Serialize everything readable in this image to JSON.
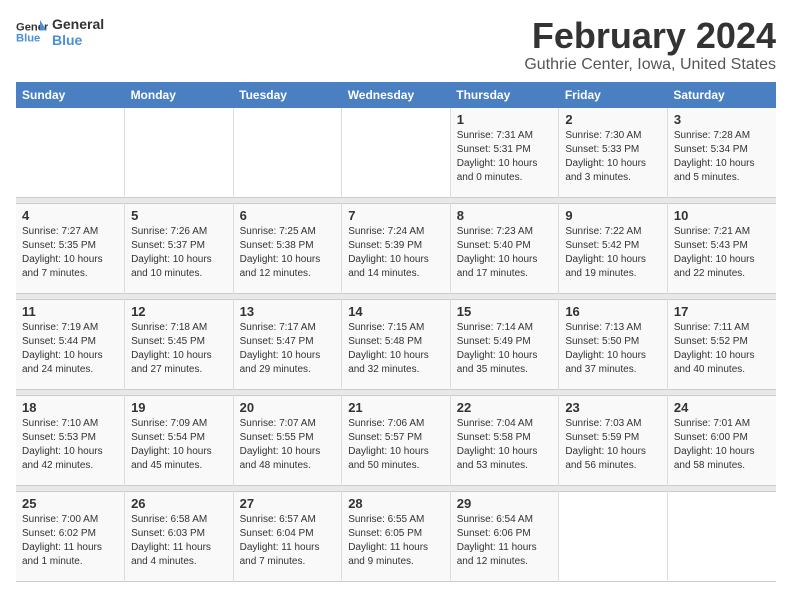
{
  "logo": {
    "line1": "General",
    "line2": "Blue"
  },
  "title": "February 2024",
  "location": "Guthrie Center, Iowa, United States",
  "weekdays": [
    "Sunday",
    "Monday",
    "Tuesday",
    "Wednesday",
    "Thursday",
    "Friday",
    "Saturday"
  ],
  "weeks": [
    [
      {
        "day": "",
        "info": ""
      },
      {
        "day": "",
        "info": ""
      },
      {
        "day": "",
        "info": ""
      },
      {
        "day": "",
        "info": ""
      },
      {
        "day": "1",
        "info": "Sunrise: 7:31 AM\nSunset: 5:31 PM\nDaylight: 10 hours\nand 0 minutes."
      },
      {
        "day": "2",
        "info": "Sunrise: 7:30 AM\nSunset: 5:33 PM\nDaylight: 10 hours\nand 3 minutes."
      },
      {
        "day": "3",
        "info": "Sunrise: 7:28 AM\nSunset: 5:34 PM\nDaylight: 10 hours\nand 5 minutes."
      }
    ],
    [
      {
        "day": "4",
        "info": "Sunrise: 7:27 AM\nSunset: 5:35 PM\nDaylight: 10 hours\nand 7 minutes."
      },
      {
        "day": "5",
        "info": "Sunrise: 7:26 AM\nSunset: 5:37 PM\nDaylight: 10 hours\nand 10 minutes."
      },
      {
        "day": "6",
        "info": "Sunrise: 7:25 AM\nSunset: 5:38 PM\nDaylight: 10 hours\nand 12 minutes."
      },
      {
        "day": "7",
        "info": "Sunrise: 7:24 AM\nSunset: 5:39 PM\nDaylight: 10 hours\nand 14 minutes."
      },
      {
        "day": "8",
        "info": "Sunrise: 7:23 AM\nSunset: 5:40 PM\nDaylight: 10 hours\nand 17 minutes."
      },
      {
        "day": "9",
        "info": "Sunrise: 7:22 AM\nSunset: 5:42 PM\nDaylight: 10 hours\nand 19 minutes."
      },
      {
        "day": "10",
        "info": "Sunrise: 7:21 AM\nSunset: 5:43 PM\nDaylight: 10 hours\nand 22 minutes."
      }
    ],
    [
      {
        "day": "11",
        "info": "Sunrise: 7:19 AM\nSunset: 5:44 PM\nDaylight: 10 hours\nand 24 minutes."
      },
      {
        "day": "12",
        "info": "Sunrise: 7:18 AM\nSunset: 5:45 PM\nDaylight: 10 hours\nand 27 minutes."
      },
      {
        "day": "13",
        "info": "Sunrise: 7:17 AM\nSunset: 5:47 PM\nDaylight: 10 hours\nand 29 minutes."
      },
      {
        "day": "14",
        "info": "Sunrise: 7:15 AM\nSunset: 5:48 PM\nDaylight: 10 hours\nand 32 minutes."
      },
      {
        "day": "15",
        "info": "Sunrise: 7:14 AM\nSunset: 5:49 PM\nDaylight: 10 hours\nand 35 minutes."
      },
      {
        "day": "16",
        "info": "Sunrise: 7:13 AM\nSunset: 5:50 PM\nDaylight: 10 hours\nand 37 minutes."
      },
      {
        "day": "17",
        "info": "Sunrise: 7:11 AM\nSunset: 5:52 PM\nDaylight: 10 hours\nand 40 minutes."
      }
    ],
    [
      {
        "day": "18",
        "info": "Sunrise: 7:10 AM\nSunset: 5:53 PM\nDaylight: 10 hours\nand 42 minutes."
      },
      {
        "day": "19",
        "info": "Sunrise: 7:09 AM\nSunset: 5:54 PM\nDaylight: 10 hours\nand 45 minutes."
      },
      {
        "day": "20",
        "info": "Sunrise: 7:07 AM\nSunset: 5:55 PM\nDaylight: 10 hours\nand 48 minutes."
      },
      {
        "day": "21",
        "info": "Sunrise: 7:06 AM\nSunset: 5:57 PM\nDaylight: 10 hours\nand 50 minutes."
      },
      {
        "day": "22",
        "info": "Sunrise: 7:04 AM\nSunset: 5:58 PM\nDaylight: 10 hours\nand 53 minutes."
      },
      {
        "day": "23",
        "info": "Sunrise: 7:03 AM\nSunset: 5:59 PM\nDaylight: 10 hours\nand 56 minutes."
      },
      {
        "day": "24",
        "info": "Sunrise: 7:01 AM\nSunset: 6:00 PM\nDaylight: 10 hours\nand 58 minutes."
      }
    ],
    [
      {
        "day": "25",
        "info": "Sunrise: 7:00 AM\nSunset: 6:02 PM\nDaylight: 11 hours\nand 1 minute."
      },
      {
        "day": "26",
        "info": "Sunrise: 6:58 AM\nSunset: 6:03 PM\nDaylight: 11 hours\nand 4 minutes."
      },
      {
        "day": "27",
        "info": "Sunrise: 6:57 AM\nSunset: 6:04 PM\nDaylight: 11 hours\nand 7 minutes."
      },
      {
        "day": "28",
        "info": "Sunrise: 6:55 AM\nSunset: 6:05 PM\nDaylight: 11 hours\nand 9 minutes."
      },
      {
        "day": "29",
        "info": "Sunrise: 6:54 AM\nSunset: 6:06 PM\nDaylight: 11 hours\nand 12 minutes."
      },
      {
        "day": "",
        "info": ""
      },
      {
        "day": "",
        "info": ""
      }
    ]
  ]
}
